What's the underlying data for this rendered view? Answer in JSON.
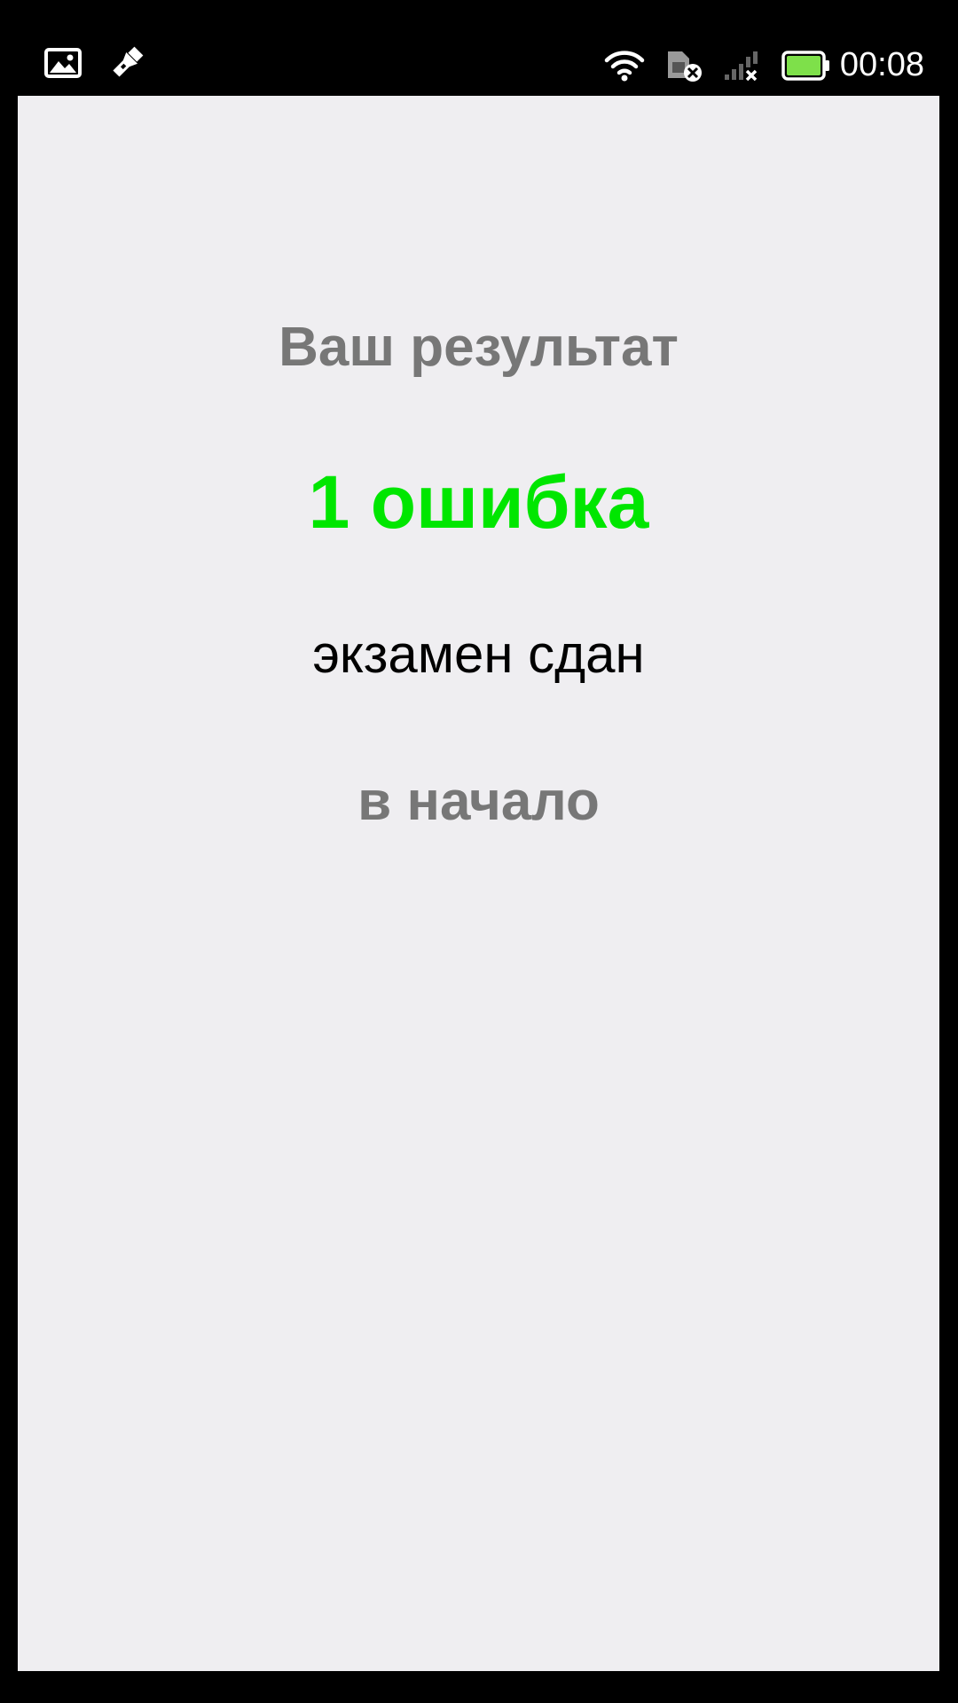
{
  "status_bar": {
    "time": "00:08",
    "icons": [
      "image-icon",
      "flashlight-icon",
      "wifi-icon",
      "sim-card-error-icon",
      "signal-no-service-icon",
      "battery-icon"
    ],
    "battery_color": "#7ee04a"
  },
  "result": {
    "title": "Ваш результат",
    "score": "1 ошибка",
    "verdict": "экзамен сдан",
    "restart_label": "в начало"
  },
  "colors": {
    "background": "#efeef1",
    "title": "#777777",
    "score": "#00e600",
    "verdict": "#000000"
  }
}
